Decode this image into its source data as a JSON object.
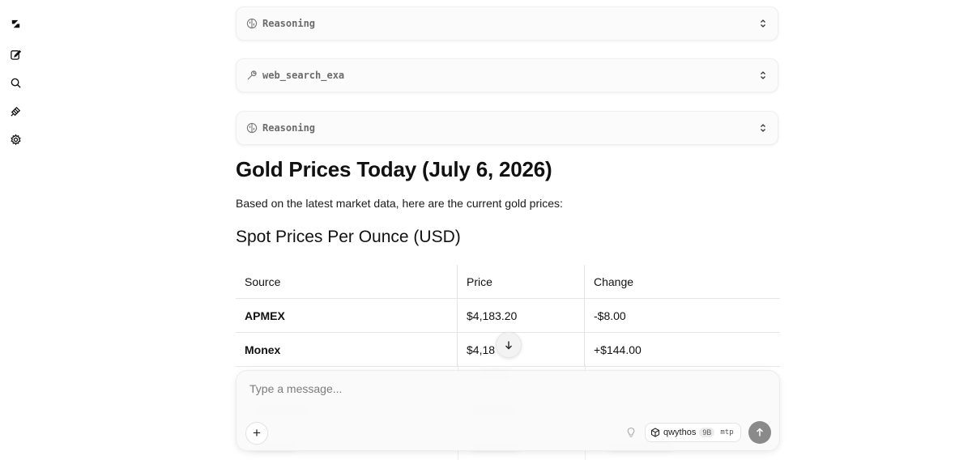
{
  "sidebar": {
    "items": [
      {
        "name": "logo-icon"
      },
      {
        "name": "new-chat-icon"
      },
      {
        "name": "search-icon"
      },
      {
        "name": "tools-icon"
      },
      {
        "name": "gear-icon"
      }
    ]
  },
  "steps": [
    {
      "type": "reasoning",
      "label": "Reasoning"
    },
    {
      "type": "tool",
      "label": "web_search_exa"
    },
    {
      "type": "reasoning",
      "label": "Reasoning"
    }
  ],
  "content": {
    "title": "Gold Prices Today (July 6, 2026)",
    "intro": "Based on the latest market data, here are the current gold prices:",
    "subtitle": "Spot Prices Per Ounce (USD)"
  },
  "table": {
    "headers": [
      "Source",
      "Price",
      "Change"
    ],
    "rows": [
      {
        "source": "APMEX",
        "price": "$4,183.20",
        "change": "-$8.00"
      },
      {
        "source": "Monex",
        "price": "$4,18",
        "change": "+$144.00"
      }
    ]
  },
  "composer": {
    "placeholder": "Type a message...",
    "plus_label": "+",
    "model": {
      "name": "qwythos",
      "size": "9B",
      "tag": "mtp"
    }
  },
  "colors": {
    "send_button": "#8a8a8a",
    "muted_text": "#6b6b6b"
  }
}
